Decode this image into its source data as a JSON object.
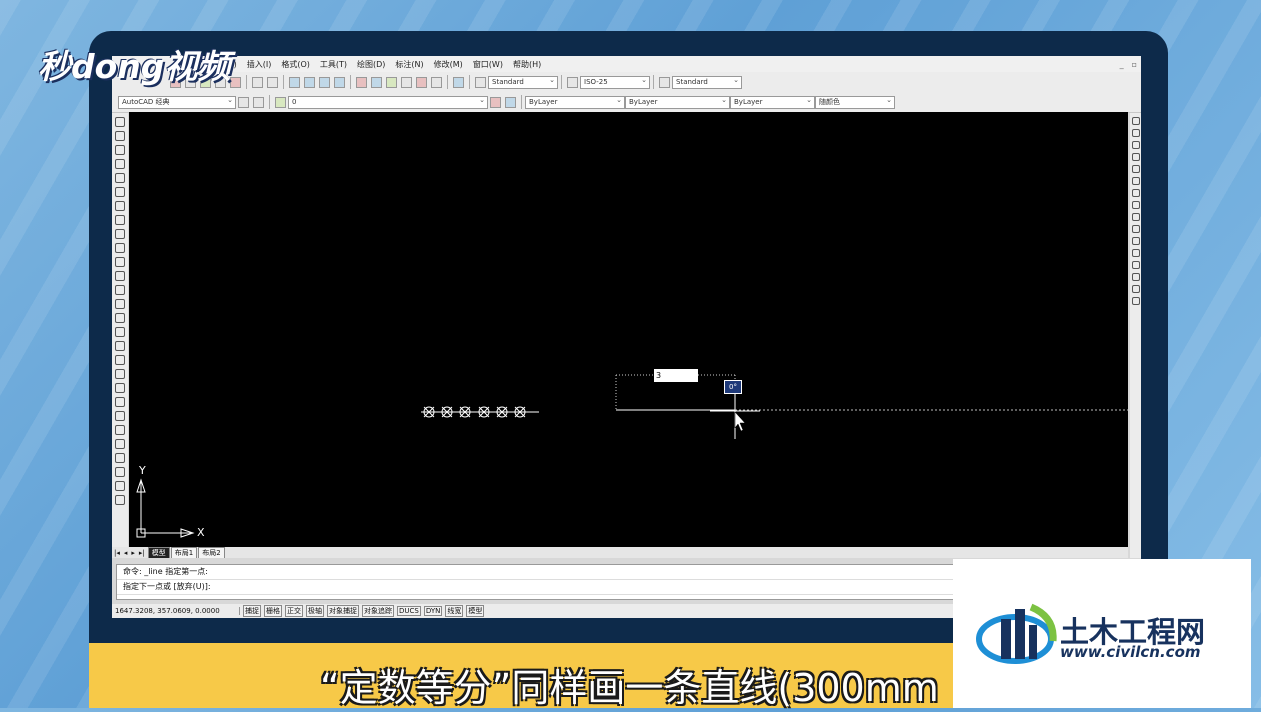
{
  "logo_text": "秒dong视频",
  "menu": [
    "视图(V)",
    "插入(I)",
    "格式(O)",
    "工具(T)",
    "绘图(D)",
    "标注(N)",
    "修改(M)",
    "窗口(W)",
    "帮助(H)"
  ],
  "toolbar1": {
    "text_style": "Standard",
    "dim_style": "ISO-25",
    "table_style": "Standard"
  },
  "toolbar2": {
    "workspace": "AutoCAD 经典",
    "layer": "0",
    "color": "ByLayer",
    "linetype": "ByLayer",
    "lineweight": "ByLayer",
    "plotstyle": "随颜色"
  },
  "canvas": {
    "dyn_input_value": "3",
    "angle_tooltip": "0°",
    "axis_y": "Y",
    "axis_x": "X"
  },
  "tabs": [
    "模型",
    "布局1",
    "布局2"
  ],
  "command_lines": [
    "命令: _line 指定第一点:",
    "指定下一点或 [放弃(U)]:"
  ],
  "status": {
    "coords": "1647.3208, 357.0609, 0.0000",
    "buttons": [
      "捕捉",
      "栅格",
      "正交",
      "极轴",
      "对象捕捉",
      "对象追踪",
      "DUCS",
      "DYN",
      "线宽",
      "模型"
    ]
  },
  "subtitle": "“定数等分”同样画一条直线(300mm",
  "watermark": {
    "title": "土木工程网",
    "url": "www.civilcn.com"
  },
  "colors": {
    "frame": "#0d2a4a",
    "subtitle_bar": "#f7c948",
    "brand_blue": "#17325e",
    "canvas_bg": "#000000"
  }
}
